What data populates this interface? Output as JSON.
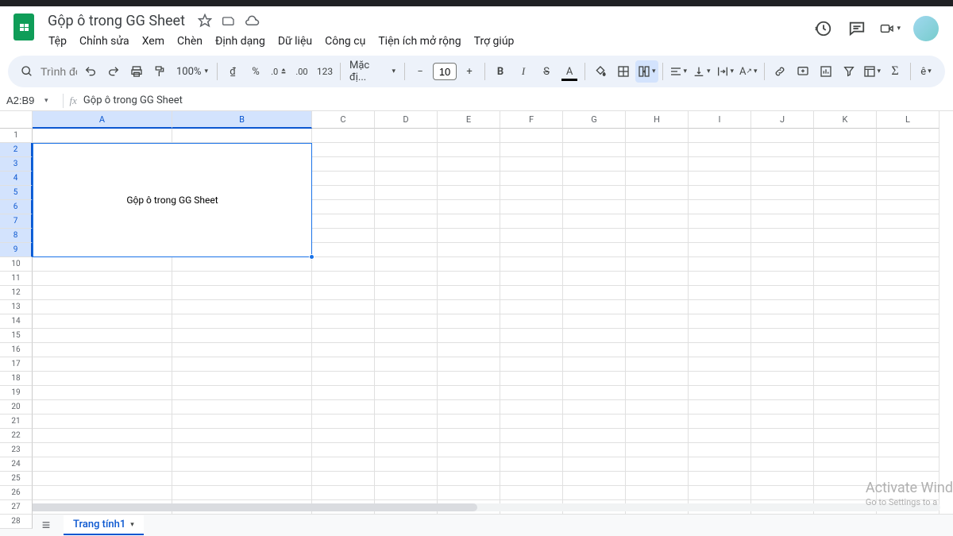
{
  "doc": {
    "title": "Gộp ô trong GG Sheet"
  },
  "menus": {
    "search_placeholder": "Trình đơn",
    "items": [
      "Tệp",
      "Chỉnh sửa",
      "Xem",
      "Chèn",
      "Định dạng",
      "Dữ liệu",
      "Công cụ",
      "Tiện ích mở rộng",
      "Trợ giúp"
    ]
  },
  "toolbar": {
    "zoom": "100%",
    "currency": "₫",
    "percent": "%",
    "dec_dec": ".0",
    "inc_dec": ".00",
    "num_fmt": "123",
    "font": "Mặc đị...",
    "font_size": "10",
    "bold": "B",
    "italic": "I",
    "strike": "S",
    "text_label": "A",
    "more": "ê"
  },
  "formula": {
    "name_box": "A2:B9",
    "fx": "fx",
    "content": "Gộp ô trong GG Sheet"
  },
  "columns": [
    "A",
    "B",
    "C",
    "D",
    "E",
    "F",
    "G",
    "H",
    "I",
    "J",
    "K",
    "L"
  ],
  "rows": [
    1,
    2,
    3,
    4,
    5,
    6,
    7,
    8,
    9,
    10,
    11,
    12,
    13,
    14,
    15,
    16,
    17,
    18,
    19,
    20,
    21,
    22,
    23,
    24,
    25,
    26,
    27,
    28
  ],
  "merged": {
    "text": "Gộp ô trong GG Sheet"
  },
  "sheets": {
    "tab1": "Trang tính1"
  },
  "watermark": {
    "line1": "Activate Wind",
    "line2": "Go to Settings to a"
  }
}
